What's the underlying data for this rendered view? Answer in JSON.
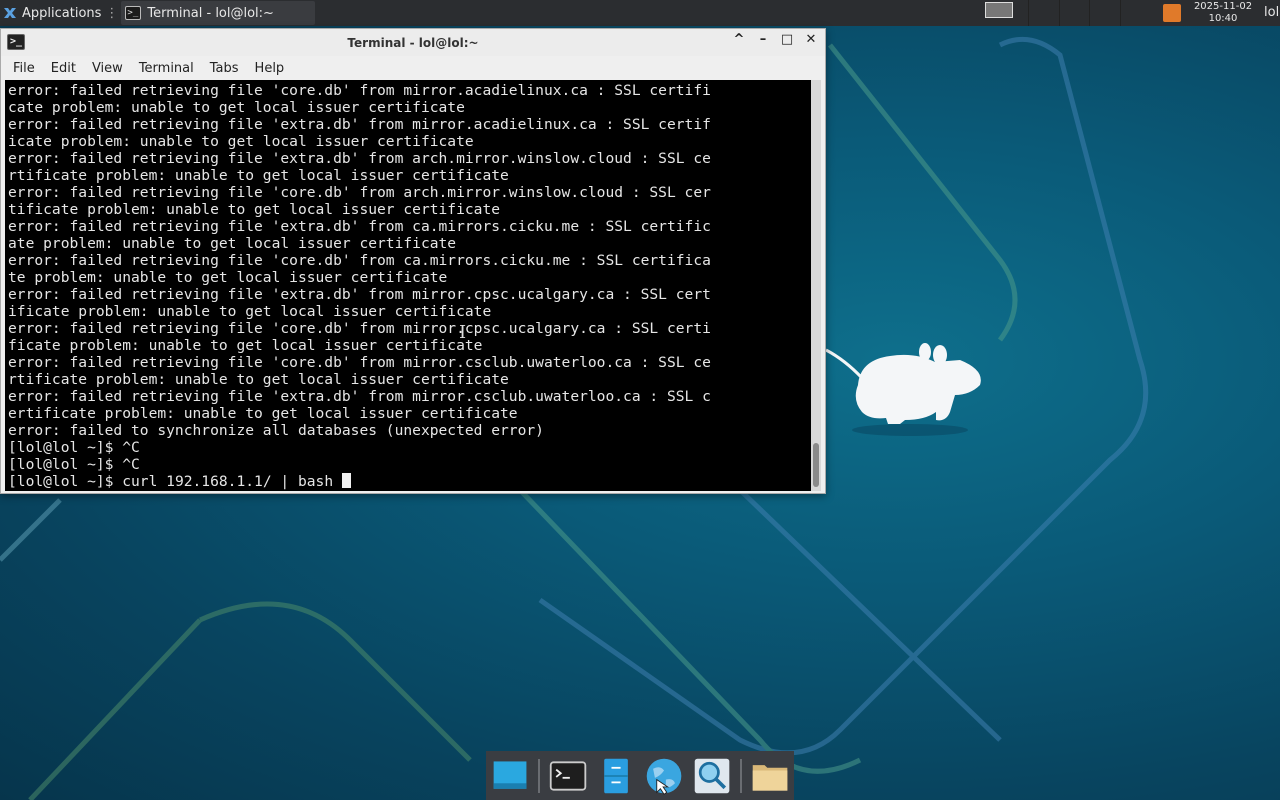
{
  "top_panel": {
    "applications_label": "Applications",
    "task_title": "Terminal - lol@lol:~",
    "clock_date": "2025-11-02",
    "clock_time": "10:40",
    "user_label": "lol"
  },
  "window": {
    "title": "Terminal - lol@lol:~",
    "controls": {
      "shade": "^",
      "minimize": "–",
      "maximize": "□",
      "close": "✕"
    }
  },
  "menu": {
    "file": "File",
    "edit": "Edit",
    "view": "View",
    "terminal": "Terminal",
    "tabs": "Tabs",
    "help": "Help"
  },
  "terminal": {
    "lines": "error: failed retrieving file 'core.db' from mirror.acadielinux.ca : SSL certifi\ncate problem: unable to get local issuer certificate\nerror: failed retrieving file 'extra.db' from mirror.acadielinux.ca : SSL certif\nicate problem: unable to get local issuer certificate\nerror: failed retrieving file 'extra.db' from arch.mirror.winslow.cloud : SSL ce\nrtificate problem: unable to get local issuer certificate\nerror: failed retrieving file 'core.db' from arch.mirror.winslow.cloud : SSL cer\ntificate problem: unable to get local issuer certificate\nerror: failed retrieving file 'extra.db' from ca.mirrors.cicku.me : SSL certific\nate problem: unable to get local issuer certificate\nerror: failed retrieving file 'core.db' from ca.mirrors.cicku.me : SSL certifica\nte problem: unable to get local issuer certificate\nerror: failed retrieving file 'extra.db' from mirror.cpsc.ucalgary.ca : SSL cert\nificate problem: unable to get local issuer certificate\nerror: failed retrieving file 'core.db' from mirror.cpsc.ucalgary.ca : SSL certi\nficate problem: unable to get local issuer certificate\nerror: failed retrieving file 'core.db' from mirror.csclub.uwaterloo.ca : SSL ce\nrtificate problem: unable to get local issuer certificate\nerror: failed retrieving file 'extra.db' from mirror.csclub.uwaterloo.ca : SSL c\nertificate problem: unable to get local issuer certificate\nerror: failed to synchronize all databases (unexpected error)\n[lol@lol ~]$ ^C\n[lol@lol ~]$ ^C",
    "prompt": "[lol@lol ~]$ ",
    "current_command": "curl 192.168.1.1/ | bash "
  },
  "dock": {
    "items": [
      "show-desktop-icon",
      "terminal-icon",
      "file-manager-icon",
      "web-browser-icon",
      "app-finder-icon",
      "home-folder-icon"
    ]
  },
  "colors": {
    "panel_bg": "#2b2d30",
    "terminal_bg": "#000000",
    "terminal_fg": "#e6e6e6",
    "desktop_bg": "#0a5a78"
  }
}
